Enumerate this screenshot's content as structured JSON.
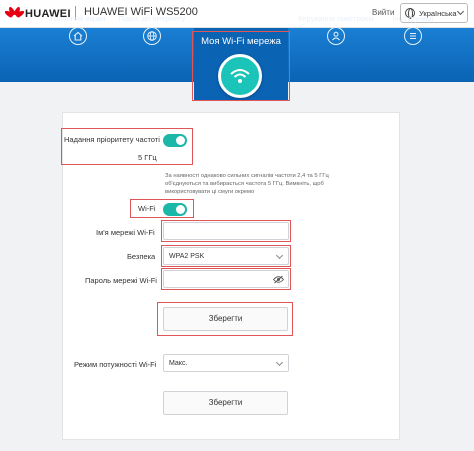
{
  "header": {
    "brand": "HUAWEI",
    "product": "HUAWEI WiFi WS5200",
    "exit_label": "Вийти",
    "language": "Українська"
  },
  "nav": {
    "items": [
      {
        "label": "Головний екран",
        "icon": "home-icon"
      },
      {
        "label": "Підкл. до інтернету",
        "icon": "globe-icon"
      },
      {
        "label": "Моя Wi-Fi мережа",
        "icon": "wifi-icon"
      },
      {
        "label": "Керування пристроєм",
        "icon": "user-icon"
      },
      {
        "label": "Інші функції",
        "icon": "menu-icon"
      }
    ],
    "active_index": 2
  },
  "settings": {
    "priority_label": "Надання пріоритету частоті",
    "priority_band": "5 ГГц",
    "priority_note": "За наявності однаково сильних сигналів частоти 2,4 та 5 ГГц об'єднуються та вибирається частота 5 ГГц. Вимкніть, щоб використовувати ці смуги окремо",
    "wifi_label": "Wi-Fi",
    "ssid_label": "Ім'я мережі Wi-Fi",
    "ssid_value": "",
    "security_label": "Безпека",
    "security_value": "WPA2 PSK",
    "password_label": "Пароль мережі Wi-Fi",
    "password_value": "",
    "save_label": "Зберегти",
    "power_label": "Режим потужності Wi-Fi",
    "power_value": "Макс.",
    "save2_label": "Зберегти"
  },
  "colors": {
    "nav_blue": "#0b63b4",
    "toggle_on": "#1bb7a8",
    "wifi_teal": "#1bc4b8",
    "highlight_red": "#e05555"
  }
}
